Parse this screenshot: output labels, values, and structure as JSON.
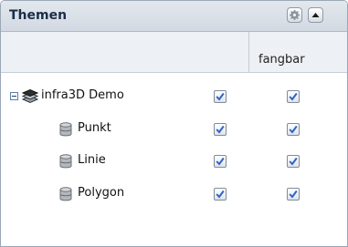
{
  "panel": {
    "title": "Themen",
    "tools": [
      {
        "name": "gear-icon"
      },
      {
        "name": "collapse-up-icon"
      }
    ]
  },
  "columns": [
    "",
    "fangbar"
  ],
  "tree": {
    "root": {
      "label": "infra3D Demo",
      "icon": "layers-icon",
      "expanded": true,
      "visible": true,
      "snappable": true
    },
    "children": [
      {
        "label": "Punkt",
        "icon": "database-icon",
        "visible": true,
        "snappable": true
      },
      {
        "label": "Linie",
        "icon": "database-icon",
        "visible": true,
        "snappable": true
      },
      {
        "label": "Polygon",
        "icon": "database-icon",
        "visible": true,
        "snappable": true
      }
    ]
  },
  "colors": {
    "header_bg": "#d9dfe7",
    "title_text": "#1a2d47",
    "check_mark": "#2f63c4"
  }
}
